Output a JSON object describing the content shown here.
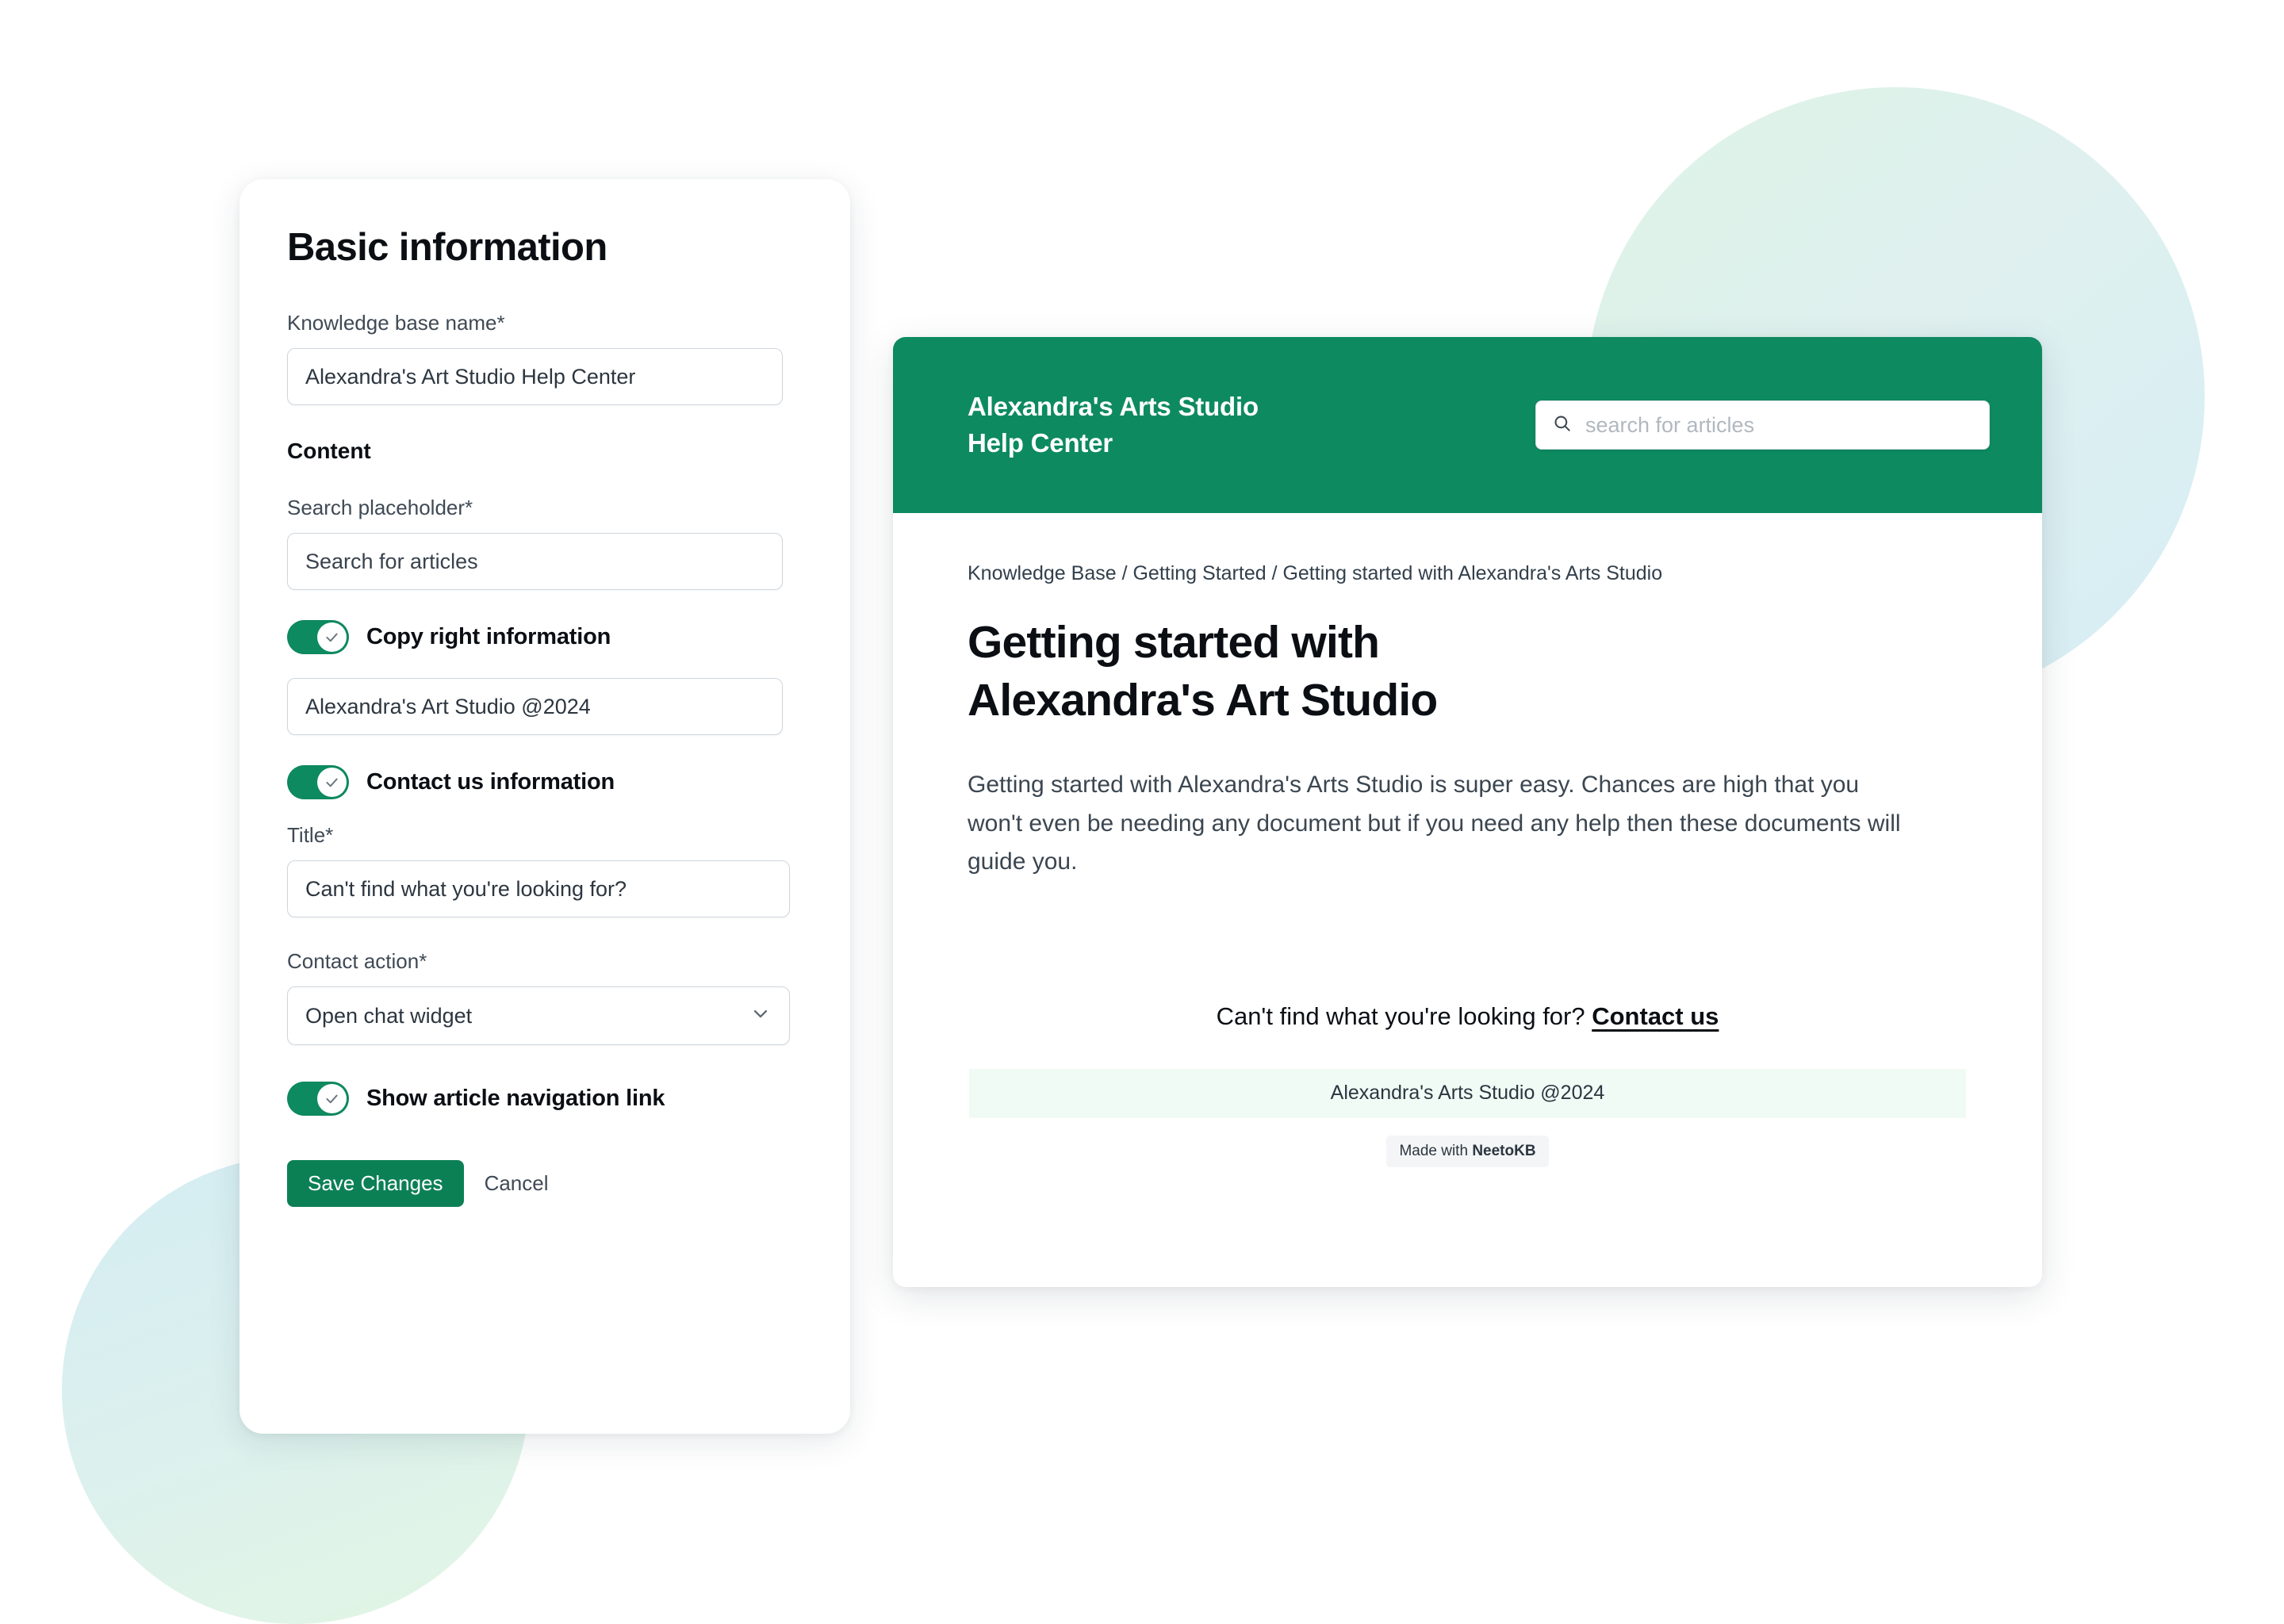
{
  "settings": {
    "title": "Basic information",
    "kb_name": {
      "label": "Knowledge base name*",
      "value": "Alexandra's Art Studio Help Center"
    },
    "content_heading": "Content",
    "search_placeholder_field": {
      "label": "Search placeholder*",
      "value": "Search for articles"
    },
    "copyright_toggle": {
      "label": "Copy right information",
      "state": "on",
      "value": "Alexandra's Art Studio @2024"
    },
    "contact_toggle": {
      "label": "Contact us information",
      "state": "on"
    },
    "contact_title": {
      "label": "Title*",
      "value": "Can't find what you're looking for?"
    },
    "contact_action": {
      "label": "Contact action*",
      "value": "Open chat widget",
      "options": [
        "Open chat widget"
      ]
    },
    "nav_toggle": {
      "label": "Show article navigation link",
      "state": "on"
    },
    "save_label": "Save Changes",
    "cancel_label": "Cancel"
  },
  "preview": {
    "kb_title": "Alexandra's Arts Studio\nHelp Center",
    "search_placeholder": "search for articles",
    "breadcrumb": "Knowledge Base / Getting Started / Getting started with Alexandra's Arts Studio",
    "article_title": "Getting started with\nAlexandra's Art Studio",
    "article_body": "Getting started with Alexandra's Arts Studio is super easy. Chances are high that you won't even be needing any document but if you need any help then these documents will guide you.",
    "contact_prompt": "Can't find what you're looking for? ",
    "contact_link": "Contact us",
    "copyright": "Alexandra's Arts Studio @2024",
    "made_with_prefix": "Made with ",
    "made_with_brand": "NeetoKB"
  },
  "colors": {
    "brand_green": "#0d8a60",
    "save_button_green": "#0c8055",
    "copyright_bar_bg": "#effbf4"
  },
  "icons": {
    "search": "search-icon",
    "chevron_down": "chevron-down-icon",
    "toggle_check": "check-icon"
  }
}
